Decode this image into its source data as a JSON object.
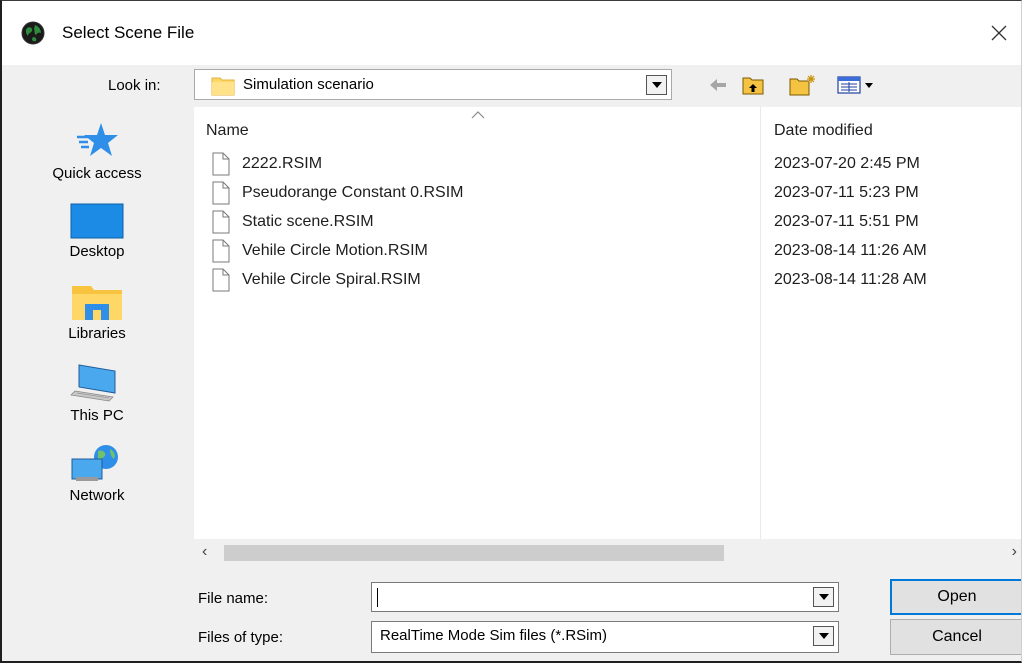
{
  "window": {
    "title": "Select Scene File"
  },
  "look_in": {
    "label": "Look in:",
    "value": "Simulation scenario"
  },
  "places": [
    {
      "label": "Quick access",
      "icon": "star-icon"
    },
    {
      "label": "Desktop",
      "icon": "desktop-icon"
    },
    {
      "label": "Libraries",
      "icon": "libraries-icon"
    },
    {
      "label": "This PC",
      "icon": "computer-icon"
    },
    {
      "label": "Network",
      "icon": "network-icon"
    }
  ],
  "file_list": {
    "columns": {
      "name": "Name",
      "date": "Date modified"
    },
    "files": [
      {
        "name": "2222.RSIM",
        "date": "2023-07-20 2:45 PM"
      },
      {
        "name": "Pseudorange Constant 0.RSIM",
        "date": "2023-07-11 5:23 PM"
      },
      {
        "name": "Static scene.RSIM",
        "date": "2023-07-11 5:51 PM"
      },
      {
        "name": "Vehile Circle Motion.RSIM",
        "date": "2023-08-14 11:26 AM"
      },
      {
        "name": "Vehile Circle Spiral.RSIM",
        "date": "2023-08-14 11:28 AM"
      }
    ]
  },
  "file_name": {
    "label": "File name:",
    "value": ""
  },
  "file_type": {
    "label": "Files of type:",
    "value": "RealTime Mode Sim files (*.RSim)"
  },
  "buttons": {
    "open": "Open",
    "cancel": "Cancel"
  },
  "colors": {
    "accent": "#0078d7",
    "folder": "#ffd766",
    "star": "#2f8ee8"
  }
}
